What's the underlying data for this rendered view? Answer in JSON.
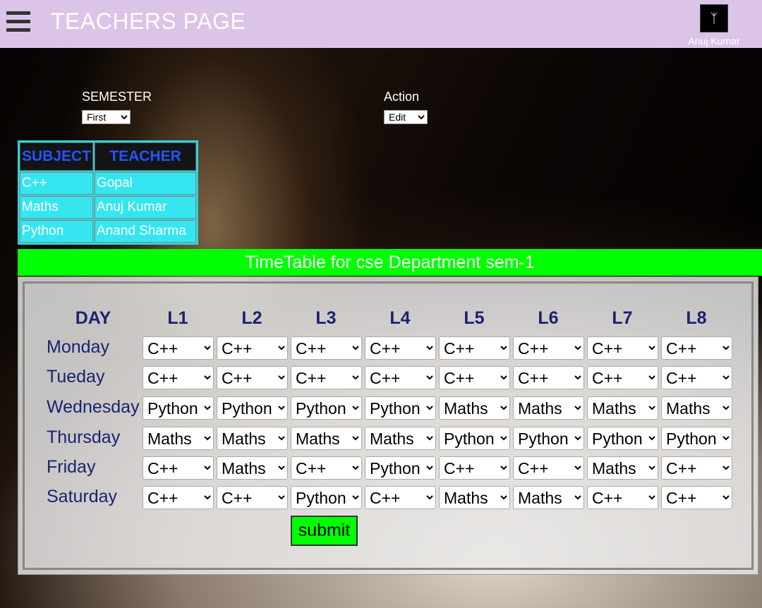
{
  "header": {
    "title": "TEACHERS PAGE",
    "user_name": "Anuj Kumar",
    "avatar_glyph": "ᛉ"
  },
  "filters": {
    "semester_label": "SEMESTER",
    "semester_value": "First",
    "action_label": "Action",
    "action_value": "Edit"
  },
  "subject_table": {
    "headers": [
      "SUBJECT",
      "TEACHER"
    ],
    "rows": [
      [
        "C++",
        "Gopal"
      ],
      [
        "Maths",
        "Anuj Kumar"
      ],
      [
        "Python",
        "Anand Sharma"
      ]
    ]
  },
  "timetable": {
    "title": "TimeTable for cse Department sem-1",
    "day_header": "DAY",
    "lectures": [
      "L1",
      "L2",
      "L3",
      "L4",
      "L5",
      "L6",
      "L7",
      "L8"
    ],
    "days": [
      {
        "name": "Monday",
        "slots": [
          "C++",
          "C++",
          "C++",
          "C++",
          "C++",
          "C++",
          "C++",
          "C++"
        ]
      },
      {
        "name": "Tueday",
        "slots": [
          "C++",
          "C++",
          "C++",
          "C++",
          "C++",
          "C++",
          "C++",
          "C++"
        ]
      },
      {
        "name": "Wednesday",
        "slots": [
          "Python",
          "Python",
          "Python",
          "Python",
          "Maths",
          "Maths",
          "Maths",
          "Maths"
        ]
      },
      {
        "name": "Thursday",
        "slots": [
          "Maths",
          "Maths",
          "Maths",
          "Maths",
          "Python",
          "Python",
          "Python",
          "Python"
        ]
      },
      {
        "name": "Friday",
        "slots": [
          "C++",
          "Maths",
          "C++",
          "Python",
          "C++",
          "C++",
          "Maths",
          "C++"
        ]
      },
      {
        "name": "Saturday",
        "slots": [
          "C++",
          "C++",
          "Python",
          "C++",
          "Maths",
          "Maths",
          "C++",
          "C++"
        ]
      }
    ],
    "submit_label": "submit"
  },
  "colors": {
    "topbar": "#dcc4e8",
    "banner": "#00ff00",
    "subject_cell": "#35e6f0",
    "header_text": "#2255ff",
    "day_text": "#1a2270"
  },
  "icons": {
    "menu": "hamburger-icon"
  }
}
